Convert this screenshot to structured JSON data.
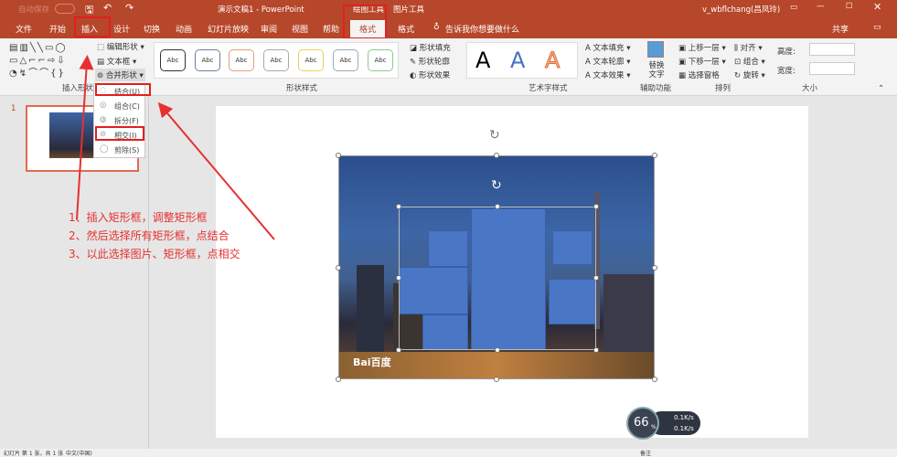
{
  "title": {
    "autosave": "自动保存",
    "doc": "演示文稿1 - PowerPoint",
    "drawing_tools": "绘图工具",
    "picture_tools": "图片工具",
    "user": "v_wbflchang(昌凤玲)"
  },
  "tabs": [
    "文件",
    "开始",
    "插入",
    "设计",
    "切换",
    "动画",
    "幻灯片放映",
    "审阅",
    "视图",
    "帮助",
    "格式",
    "格式"
  ],
  "tell_me": "告诉我你想要做什么",
  "share": "共享",
  "ribbon": {
    "edit_shape": "编辑形状",
    "textbox": "文本框",
    "merge_shapes": "合并形状",
    "insert_shapes": "插入形状",
    "abc": "Abc",
    "shape_styles": "形状样式",
    "shape_fill": "形状填充",
    "shape_outline": "形状轮廓",
    "shape_effects": "形状效果",
    "wordart_letter": "A",
    "wordart_styles": "艺术字样式",
    "text_fill": "文本填充",
    "text_outline": "文本轮廓",
    "text_effects": "文本效果",
    "alt_text": "替换文字",
    "accessibility": "辅助功能",
    "bring_forward": "上移一层",
    "send_backward": "下移一层",
    "selection_pane": "选择窗格",
    "align": "对齐",
    "group": "组合",
    "rotate": "旋转",
    "arrange": "排列",
    "height": "高度:",
    "width": "宽度:",
    "size": "大小"
  },
  "merge_menu": [
    "结合(U)",
    "组合(C)",
    "拆分(F)",
    "相交(I)",
    "剪除(S)"
  ],
  "slide_number": "1",
  "annotations": [
    "1、插入矩形框，调整矩形框",
    "2、然后选择所有矩形框，点结合",
    "3、以此选择图片、矩形框，点相交"
  ],
  "watermark": "Bai百度",
  "meter": {
    "percent": "66",
    "unit": "%",
    "up": "0.1K/s",
    "down": "0.1K/s"
  },
  "status": {
    "slide": "幻灯片 第 1 张，共 1 张",
    "lang": "中文(中国)",
    "notes": "备注"
  },
  "colors": {
    "accent": "#b7472a",
    "shape_blue": "#4a76c6",
    "annotation_red": "#e63030"
  }
}
